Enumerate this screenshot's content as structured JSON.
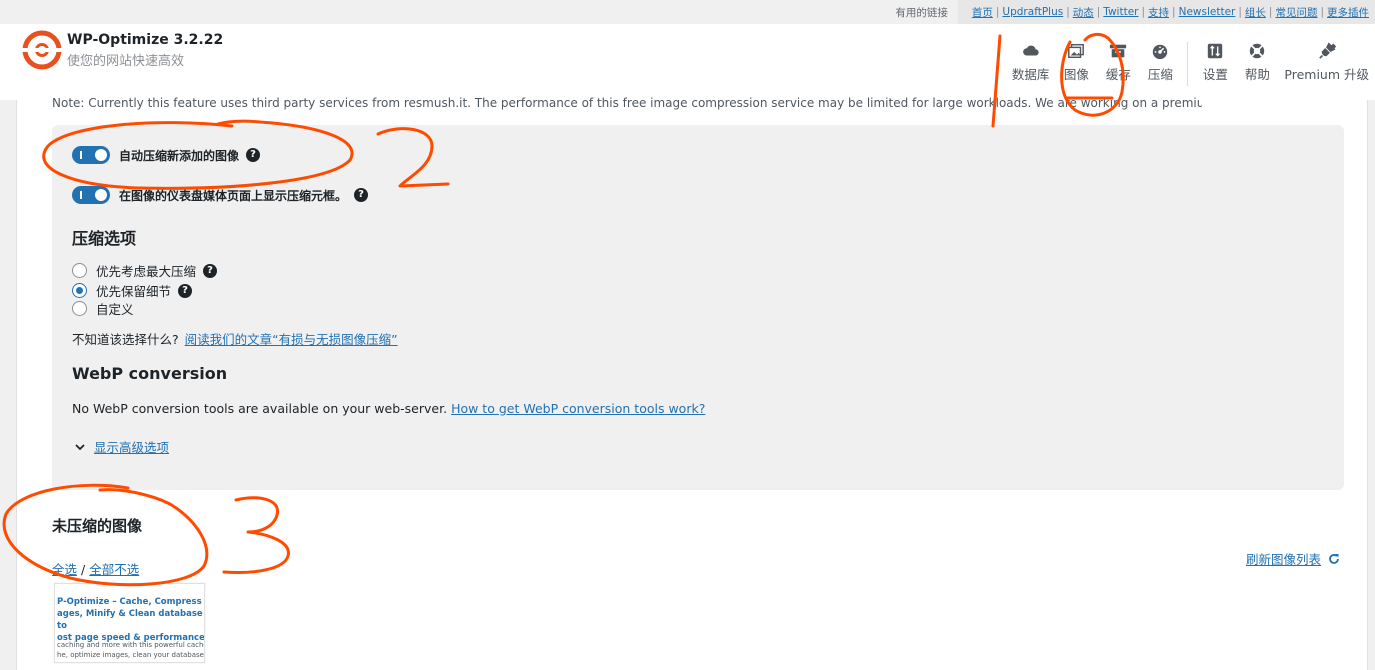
{
  "top_links": {
    "label": "有用的链接",
    "items": [
      "首页",
      "UpdraftPlus",
      "动态",
      "Twitter",
      "支持",
      "Newsletter",
      "组长",
      "常见问题",
      "更多插件"
    ]
  },
  "brand": {
    "title": "WP-Optimize 3.2.22",
    "subtitle": "使您的网站快速高效",
    "color": "#e8501e"
  },
  "nav": {
    "items": [
      {
        "label": "数据库",
        "icon": "cloud-icon"
      },
      {
        "label": "图像",
        "icon": "images-icon"
      },
      {
        "label": "缓存",
        "icon": "archive-icon"
      },
      {
        "label": "压缩",
        "icon": "dashboard-icon"
      },
      {
        "label": "设置",
        "icon": "sort-icon"
      },
      {
        "label": "帮助",
        "icon": "lifebuoy-icon"
      },
      {
        "label": "Premium 升级",
        "icon": "plugin-icon"
      }
    ]
  },
  "note": "Note: Currently this feature uses third party services from resmush.it. The performance of this free image compression service may be limited for large workloads. We are working on a premium service.",
  "toggles": {
    "auto_compress": "自动压缩新添加的图像",
    "show_meta": "在图像的仪表盘媒体页面上显示压缩元框。"
  },
  "compression": {
    "heading": "压缩选项",
    "options": [
      "优先考虑最大压缩",
      "优先保留细节",
      "自定义"
    ],
    "selected_index": 1,
    "hint_text": "不知道该选择什么?",
    "hint_link": "阅读我们的文章“有损与无损图像压缩”"
  },
  "webp": {
    "heading": "WebP conversion",
    "text": "No WebP conversion tools are available on your web-server.",
    "link": "How to get WebP conversion tools work?"
  },
  "advanced_link": "显示高级选项",
  "uncompressed": {
    "heading": "未压缩的图像",
    "select_all": "全选",
    "divider": "/",
    "select_none": "全部不选",
    "refresh": "刷新图像列表"
  },
  "thumbnail": {
    "title_lines": [
      "P-Optimize – Cache, Compress",
      "ages, Minify & Clean database to",
      "ost page speed & performance"
    ],
    "body_lines": [
      "caching and more with this powerful cache plugin",
      "he, optimize images, clean your database and mini"
    ]
  },
  "annotations": {
    "color": "#ff4b00",
    "labels": [
      "1",
      "2",
      "3"
    ]
  },
  "colors": {
    "accent": "#2271b1",
    "panel": "#f0f0f1"
  }
}
